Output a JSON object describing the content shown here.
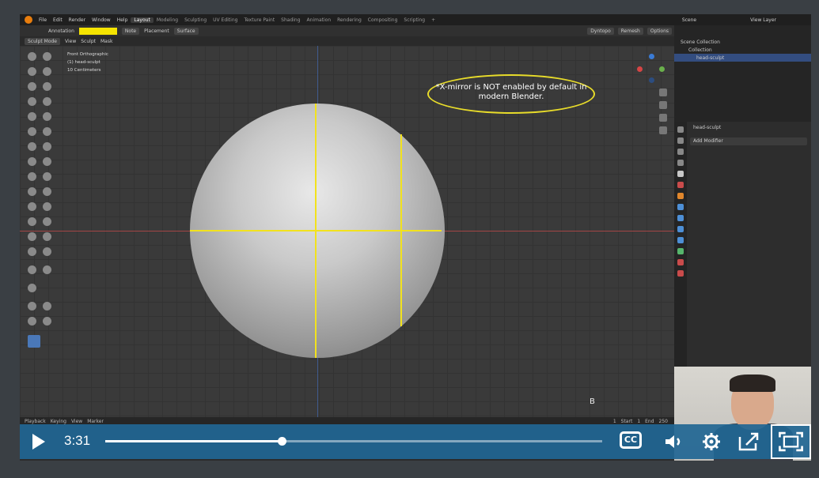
{
  "blender": {
    "menu": [
      "File",
      "Edit",
      "Render",
      "Window",
      "Help"
    ],
    "workspaces": [
      "Layout",
      "Modeling",
      "Sculpting",
      "UV Editing",
      "Texture Paint",
      "Shading",
      "Animation",
      "Rendering",
      "Compositing",
      "Scripting"
    ],
    "active_workspace": "Layout",
    "scene": "Scene",
    "view_layer": "View Layer",
    "header": {
      "annotation": "Annotation",
      "note": "Note",
      "placement": "Placement",
      "surface": "Surface",
      "mode": "Sculpt Mode",
      "view": "View",
      "sculpt": "Sculpt",
      "mask": "Mask",
      "dyntopo": "Dyntopo",
      "remesh": "Remesh",
      "options": "Options"
    },
    "viewport_info": [
      "Front Orthographic",
      "(1) head-sculpt",
      "10 Centimeters"
    ],
    "callout": "*X-mirror is NOT enabled by default in modern Blender.",
    "key_hint": "B",
    "timeline": {
      "playback": "Playback",
      "keying": "Keying",
      "view": "View",
      "marker": "Marker",
      "frame": "1",
      "start_label": "Start",
      "start": "1",
      "end_label": "End",
      "end": "250"
    },
    "outliner": {
      "scene_collection": "Scene Collection",
      "collection": "Collection",
      "object": "head-sculpt"
    },
    "properties": {
      "object": "head-sculpt",
      "add_modifier": "Add Modifier"
    }
  },
  "player": {
    "time": "3:31",
    "progress": 0.355,
    "cc_label": "CC"
  },
  "colors": {
    "accent_yellow": "#f2e21d",
    "player_blue": "#216694",
    "selection_blue": "#334d80"
  }
}
